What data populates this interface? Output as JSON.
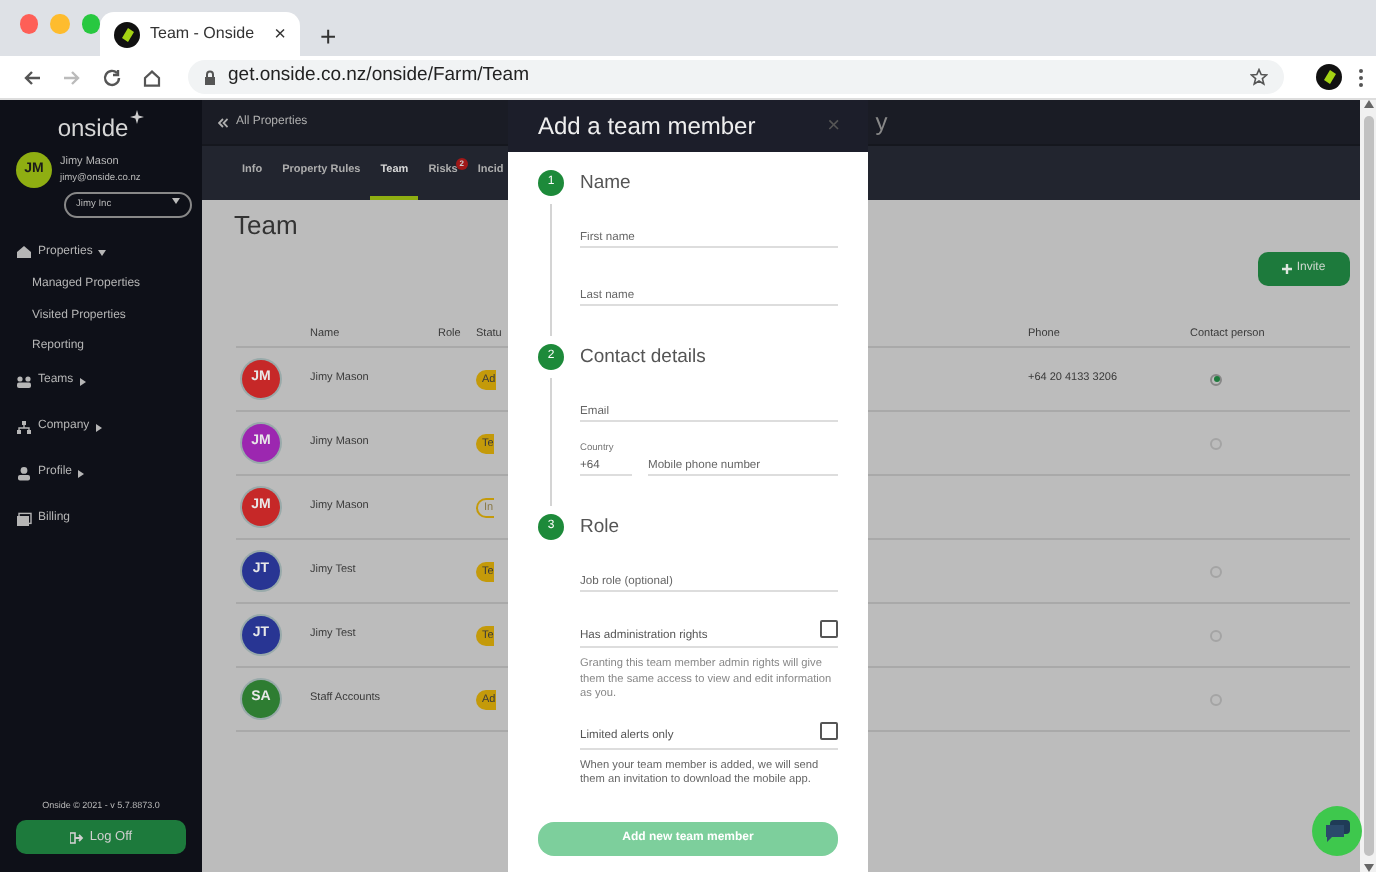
{
  "browser": {
    "tab_title": "Team - Onside",
    "tab_close": "×",
    "new_tab": "+",
    "url": "get.onside.co.nz/onside/Farm/Team"
  },
  "sidebar": {
    "logo": "onside",
    "user": {
      "initials": "JM",
      "name": "Jimy Mason",
      "email": "jimy@onside.co.nz"
    },
    "company_select": "Jimy Inc",
    "nav": [
      {
        "label": "Properties",
        "expanded": true,
        "children": [
          {
            "label": "Managed Properties"
          },
          {
            "label": "Visited Properties"
          },
          {
            "label": "Reporting"
          }
        ]
      },
      {
        "label": "Teams",
        "expanded": false
      },
      {
        "label": "Company",
        "expanded": false
      },
      {
        "label": "Profile",
        "expanded": false
      },
      {
        "label": "Billing"
      }
    ],
    "footer": "Onside © 2021 - v 5.7.8873.0",
    "logout_button": "Log Off"
  },
  "header": {
    "back_link": "All Properties",
    "title_fragment": "y"
  },
  "tabs": [
    {
      "label": "Info",
      "selected": false
    },
    {
      "label": "Property Rules",
      "selected": false
    },
    {
      "label": "Team",
      "selected": true
    },
    {
      "label": "Risks",
      "selected": false,
      "badge": "2"
    },
    {
      "label": "Incid",
      "selected": false
    }
  ],
  "page_title": "Team",
  "invite_button": "Invite",
  "table": {
    "columns": [
      "Name",
      "Role",
      "Statu",
      "Phone",
      "Contact person"
    ],
    "rows": [
      {
        "initials": "JM",
        "color": "#c62828",
        "name": "Jimy Mason",
        "status": "Ad",
        "kind": "filled",
        "phone": "+64 20 4133 3206",
        "selected": true
      },
      {
        "initials": "JM",
        "color": "#9c27b0",
        "name": "Jimy Mason",
        "status": "Te",
        "kind": "filled",
        "selected": false
      },
      {
        "initials": "JM",
        "color": "#c62828",
        "name": "Jimy Mason",
        "status": "In",
        "kind": "outline"
      },
      {
        "initials": "JT",
        "color": "#283593",
        "name": "Jimy Test",
        "status": "Te",
        "kind": "filled",
        "selected": false
      },
      {
        "initials": "JT",
        "color": "#283593",
        "name": "Jimy Test",
        "status": "Te",
        "kind": "filled",
        "selected": false
      },
      {
        "initials": "SA",
        "color": "#2e7d32",
        "name": "Staff Accounts",
        "status": "Ad",
        "kind": "filled",
        "selected": false
      }
    ]
  },
  "modal": {
    "title": "Add a team member",
    "close": "×",
    "steps": [
      {
        "number": "1",
        "title": "Name",
        "fields": [
          {
            "kind": "text",
            "placeholder": "First name"
          },
          {
            "kind": "text",
            "placeholder": "Last name"
          }
        ]
      },
      {
        "number": "2",
        "title": "Contact details",
        "fields": [
          {
            "kind": "text",
            "placeholder": "Email"
          },
          {
            "kind": "phone",
            "country_label": "Country",
            "country_value": "+64",
            "placeholder": "Mobile phone number"
          }
        ]
      },
      {
        "number": "3",
        "title": "Role",
        "fields": [
          {
            "kind": "text",
            "placeholder": "Job role (optional)"
          },
          {
            "kind": "checkbox",
            "label": "Has administration rights",
            "checked": false,
            "help": "Granting this team member admin rights will give them the same access to view and edit information as you."
          },
          {
            "kind": "checkbox",
            "label": "Limited alerts only",
            "checked": false,
            "help": "When your team member is added, we will send them an invitation to download the mobile app."
          }
        ]
      }
    ],
    "submit_button": "Add new team member"
  }
}
